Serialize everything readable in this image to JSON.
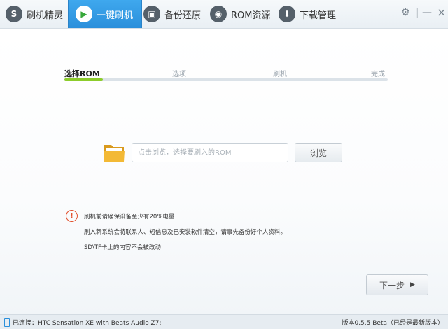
{
  "tabs": [
    {
      "label": "刷机精灵",
      "icon": "S"
    },
    {
      "label": "一键刷机",
      "icon": "▶"
    },
    {
      "label": "备份还原",
      "icon": "▣"
    },
    {
      "label": "ROM资源",
      "icon": "◉"
    },
    {
      "label": "下载管理",
      "icon": "⬇"
    }
  ],
  "window_controls": {
    "settings": "⚙",
    "divider": "|",
    "minimize": "—",
    "close": "×"
  },
  "steps": [
    {
      "label": "选择ROM"
    },
    {
      "label": "选项"
    },
    {
      "label": "刷机"
    },
    {
      "label": "完成"
    }
  ],
  "progress": {
    "current_step": 1,
    "total_steps": 4,
    "fraction": 0.12
  },
  "rom_picker": {
    "placeholder": "点击浏览，选择要刷入的ROM",
    "value": "",
    "browse_label": "浏览"
  },
  "warning": {
    "icon": "!",
    "lines": [
      "刷机前请确保设备至少有20%电量",
      "刷入新系统会将联系人、短信息及已安装软件清空，请事先备份好个人资料。",
      "SD\\TF卡上的内容不会被改动"
    ]
  },
  "next_button": {
    "label": "下一步",
    "arrow": "▶"
  },
  "status": {
    "connected": "已连接：HTC Sensation XE with Beats Audio Z7:",
    "version": "版本0.5.5 Beta（已经是最新版本）"
  },
  "colors": {
    "accent_blue": "#2a8fdb",
    "progress_green": "#8ccc2b",
    "warning_red": "#e2502d"
  }
}
